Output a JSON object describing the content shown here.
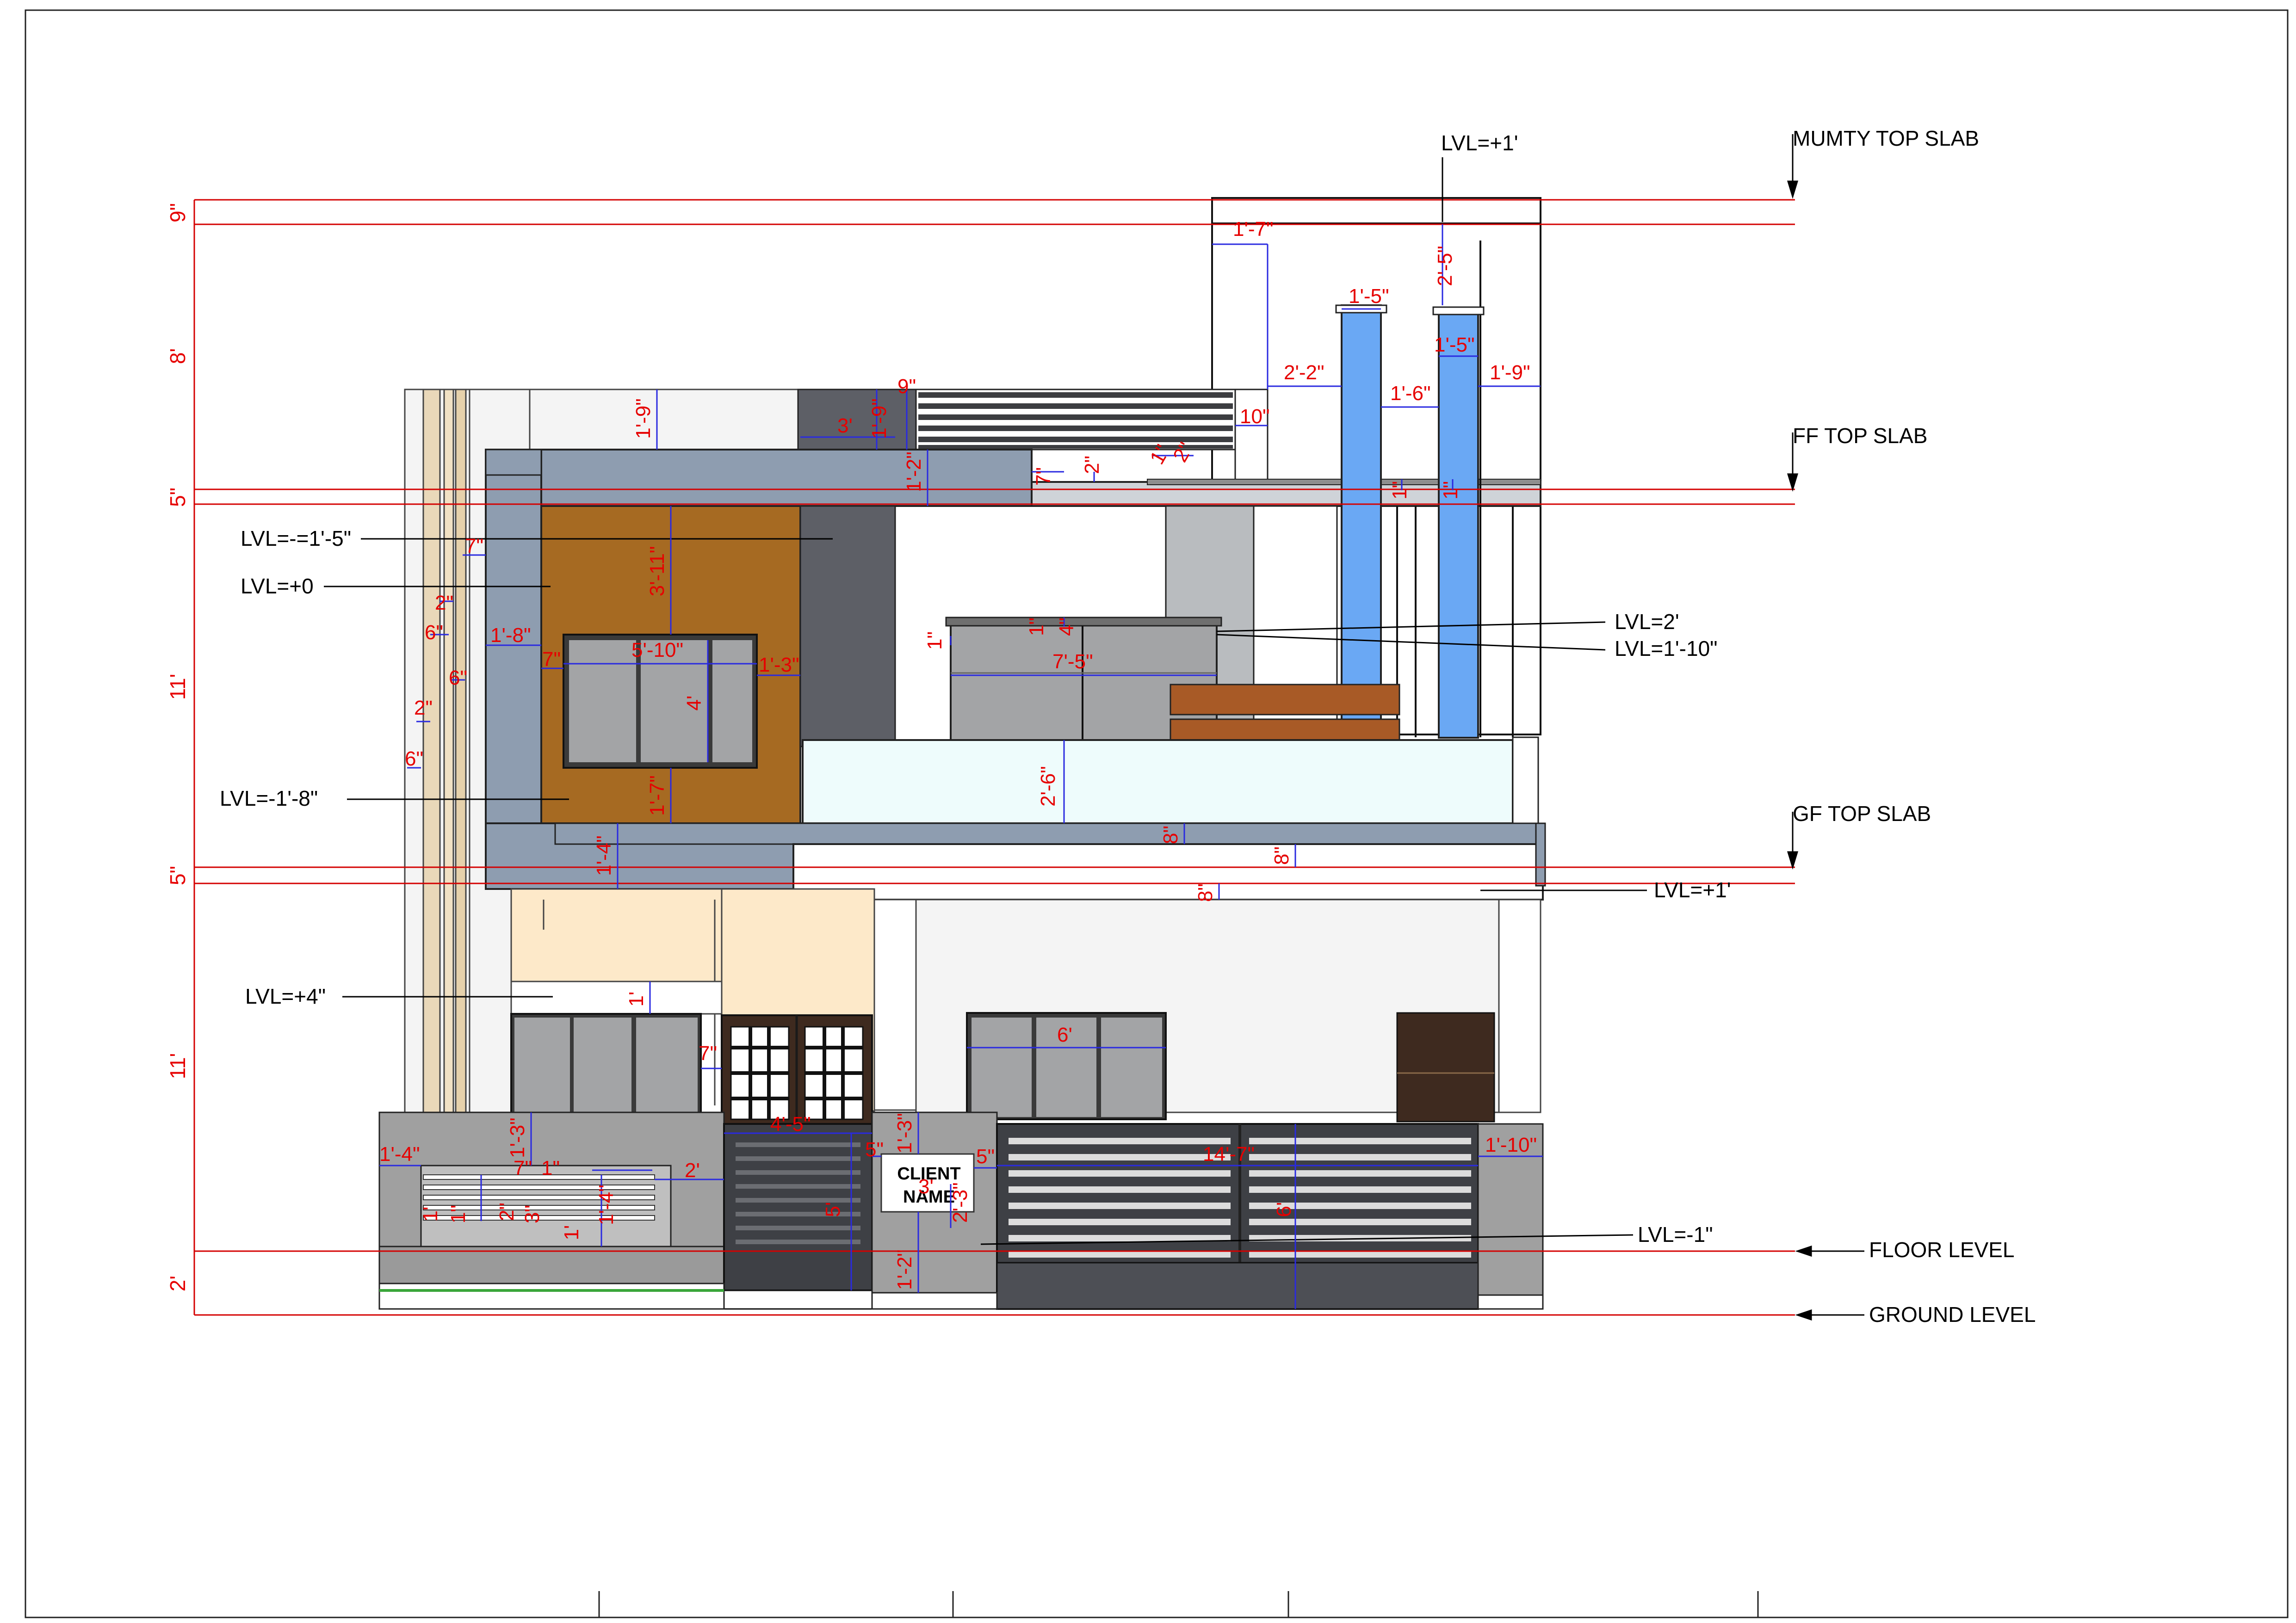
{
  "level_labels": {
    "mumty_top_slab": "MUMTY TOP SLAB",
    "ff_top_slab": "FF TOP SLAB",
    "gf_top_slab": "GF TOP SLAB",
    "floor_level": "FLOOR LEVEL",
    "ground_level": "GROUND LEVEL"
  },
  "lvl_notes": {
    "mumty": "LVL=+1'",
    "box_top": "LVL=-=1'-5\"",
    "box_zero": "LVL=+0",
    "box_bottom": "LVL=-1'-8\"",
    "canopy_gf": "LVL=+4\"",
    "balcony_2": "LVL=2'",
    "balcony_1_10": "LVL=1'-10\"",
    "chajja": "LVL=+1'",
    "gate": "LVL=-1\""
  },
  "side_dims": [
    "9\"",
    "8'",
    "5\"",
    "11'",
    "5\"",
    "11'",
    "2'"
  ],
  "dims": {
    "d_1_7": "1'-7\"",
    "d_2_5": "2'-5\"",
    "d_1_5a": "1'-5\"",
    "d_1_5b": "1'-5\"",
    "d_2_2": "2'-2\"",
    "d_1_6": "1'-6\"",
    "d_1_9r": "1'-9\"",
    "d_9": "9\"",
    "d_1_9": "1'-9\"",
    "d_1_9b": "1'-9\"",
    "d_3": "3'",
    "d_10": "10\"",
    "d_1_2": "1'-2\"",
    "d_7": "7\"",
    "d_2": "2\"",
    "d_1s": "1\"",
    "d_2s": "2\"",
    "d_3_11": "3'-11\"",
    "d_7b": "7\"",
    "d_2c": "2\"",
    "d_6": "6\"",
    "d_1_8": "1'-8\"",
    "d_5_10": "5'-10\"",
    "d_7c": "7\"",
    "d_1_3": "1'-3\"",
    "d_4": "4'",
    "d_6b": "6\"",
    "d_2d": "2\"",
    "d_6c": "6\"",
    "d_1_7b": "1'-7\"",
    "d_1_4": "1'-4\"",
    "d_1a": "1\"",
    "d_4a": "4\"",
    "d_1b": "1\"",
    "d_7_5": "7'-5\"",
    "d_2_6": "2'-6\"",
    "d_8a": "8\"",
    "d_8b": "8\"",
    "d_8c": "8\"",
    "d_1f": "1'",
    "d_7d": "7\"",
    "d_6ft": "6'",
    "d_1_3b": "1'-3\"",
    "d_4_5": "4'-5\"",
    "d_5": "5\"",
    "d_1_3c": "1'-3\"",
    "d_5b": "5\"",
    "d_14_7": "14'-7\"",
    "d_1_10": "1'-10\"",
    "d_1_4b": "1'-4\"",
    "d_7e": "7\"",
    "d_1e": "1\"",
    "d_2e": "2'",
    "d_1_4c": "1'-4\"",
    "d_1g": "1'",
    "d_5c": "5'",
    "d_3b": "3'",
    "d_2_3": "2'-3\"",
    "d_6d": "6'",
    "d_1_2b": "1'-2\"",
    "d_2f": "2\"",
    "d_1h": "1'",
    "d_1i": "1\"",
    "d_3c": "3\"",
    "d_1j": "1\"",
    "d_1k": "1\""
  },
  "sign": {
    "line1": "CLIENT",
    "line2": "NAME"
  },
  "colors": {
    "slab_blue_grey": "#8e9db0",
    "wood_brown": "#a66a22",
    "dark_grey": "#5d5f66",
    "glass_grey": "#a3a4a6",
    "pillar_blue": "#6aa8f4",
    "balcony_glass": "#eefcfc",
    "cream": "#fde9c9",
    "light_wall": "#f4f4f4",
    "gate_dark": "#3e4045",
    "wood_door": "#3e2a1f",
    "plinth_grey": "#a0a0a0",
    "dim_red": "#e60000",
    "dim_blue": "#2a2ae0"
  }
}
